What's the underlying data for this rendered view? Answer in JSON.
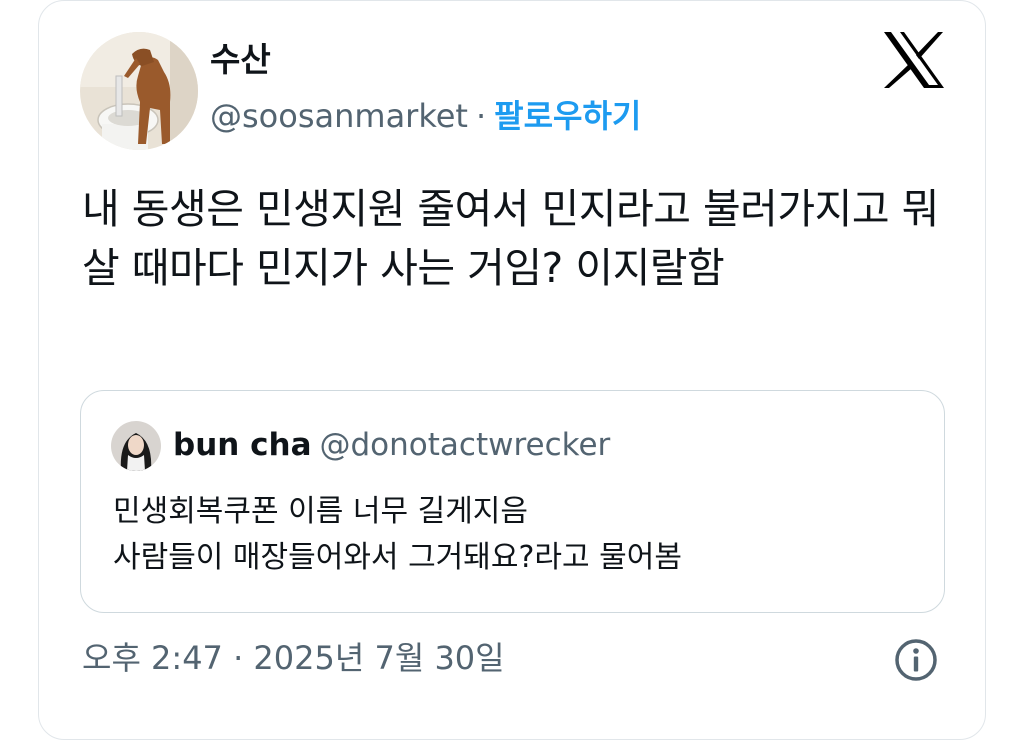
{
  "author": {
    "display_name": "수산",
    "handle": "@soosanmarket",
    "separator": "·",
    "follow_label": "팔로우하기",
    "avatar_icon": "dog-avatar-icon"
  },
  "brand": {
    "logo_icon": "x-logo-icon",
    "color": "#000000"
  },
  "tweet": {
    "text": "내 동생은 민생지원 줄여서 민지라고 불러가지고 뭐 살 때마다 민지가 사는 거임? 이지랄함"
  },
  "quoted_tweet": {
    "display_name": "bun cha",
    "handle": "@donotactwrecker",
    "line1": "민생회복쿠폰 이름 너무 길게지음",
    "line2": "사람들이 매장들어와서 그거돼요?라고 물어봄",
    "avatar_icon": "person-avatar-icon"
  },
  "meta": {
    "timestamp": "오후 2:47 · 2025년 7월 30일",
    "info_icon": "info-icon"
  },
  "colors": {
    "accent": "#1d9bf0",
    "secondary_text": "#536471",
    "primary_text": "#0f1419",
    "border": "#cfd9de"
  }
}
